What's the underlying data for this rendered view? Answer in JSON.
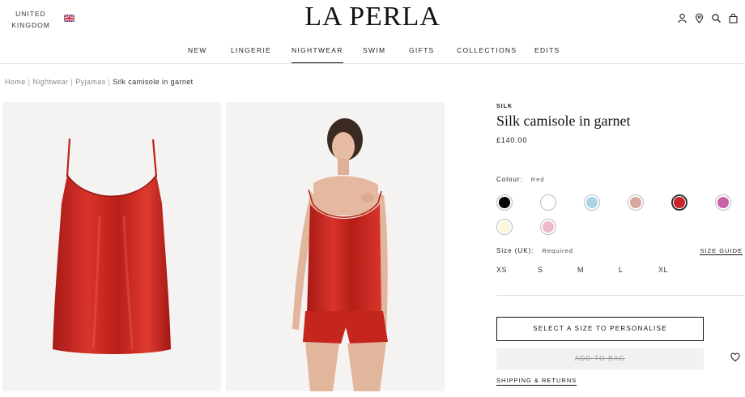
{
  "header": {
    "region_line1": "UNITED",
    "region_line2": "KINGDOM",
    "logo": "LA PERLA",
    "icons": [
      "account-icon",
      "store-locator-icon",
      "search-icon",
      "bag-icon"
    ],
    "nav": [
      "NEW",
      "LINGERIE",
      "NIGHTWEAR",
      "SWIM",
      "GIFTS",
      "COLLECTIONS",
      "EDITS"
    ],
    "active_nav": "NIGHTWEAR"
  },
  "breadcrumb": [
    "Home",
    "Nightwear",
    "Pyjamas",
    "Silk camisole in garnet"
  ],
  "product": {
    "brand_tag": "SILK",
    "title": "Silk camisole in garnet",
    "price": "£140.00",
    "colour_label": "Colour:",
    "colour_selected": "Red",
    "swatches": [
      {
        "color": "#000000",
        "active": false
      },
      {
        "color": "#ffffff",
        "active": false
      },
      {
        "color": "#a9d4e6",
        "active": false
      },
      {
        "color": "#d9a69a",
        "active": false
      },
      {
        "color": "#c8242b",
        "active": true
      },
      {
        "color": "#c764a8",
        "active": false
      },
      {
        "color": "#fbf6dc",
        "active": false
      },
      {
        "color": "#f0b8cd",
        "active": false
      }
    ],
    "size_label": "Size (UK):",
    "size_required": "Required",
    "size_guide": "SIZE GUIDE",
    "sizes": [
      "XS",
      "S",
      "M",
      "L",
      "XL"
    ],
    "personalise_button": "SELECT A SIZE TO PERSONALISE",
    "add_to_bag": "ADD TO BAG",
    "shipping_link": "SHIPPING & RETURNS"
  },
  "colors": {
    "garment": "#c8261f",
    "panel_bg": "#f5f3f2",
    "text": "#111111"
  }
}
